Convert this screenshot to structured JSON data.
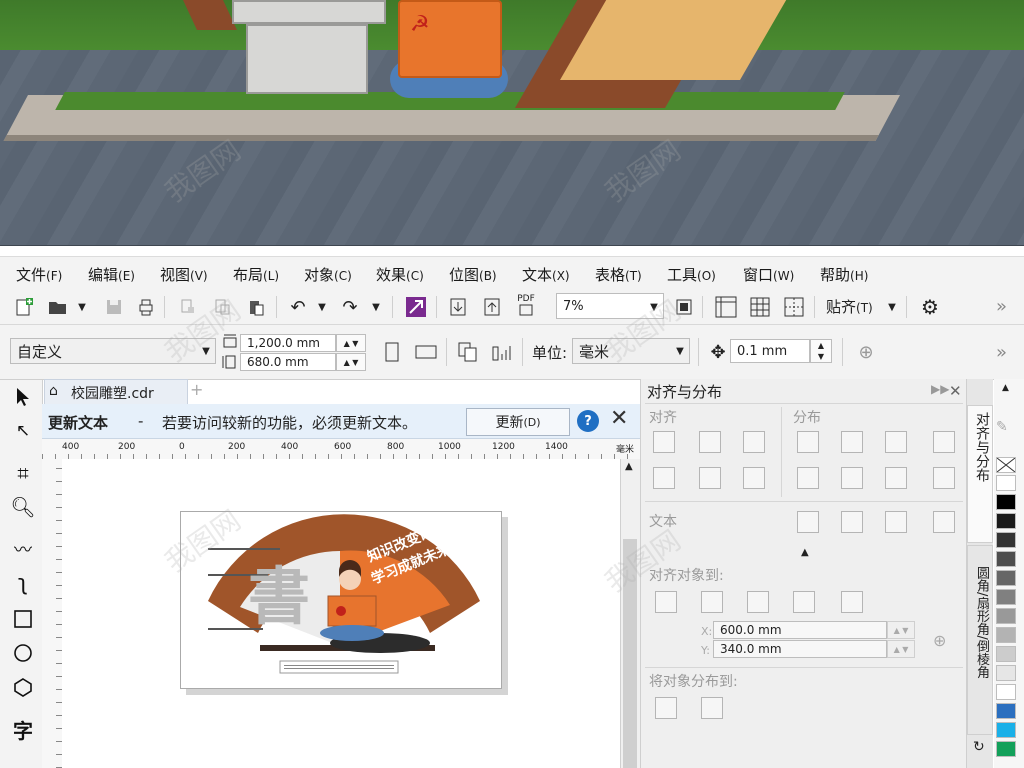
{
  "menu": {
    "items": [
      {
        "label": "文件",
        "key": "(F)"
      },
      {
        "label": "编辑",
        "key": "(E)"
      },
      {
        "label": "视图",
        "key": "(V)"
      },
      {
        "label": "布局",
        "key": "(L)"
      },
      {
        "label": "对象",
        "key": "(C)"
      },
      {
        "label": "效果",
        "key": "(C)"
      },
      {
        "label": "位图",
        "key": "(B)"
      },
      {
        "label": "文本",
        "key": "(X)"
      },
      {
        "label": "表格",
        "key": "(T)"
      },
      {
        "label": "工具",
        "key": "(O)"
      },
      {
        "label": "窗口",
        "key": "(W)"
      },
      {
        "label": "帮助",
        "key": "(H)"
      }
    ]
  },
  "toolbar": {
    "zoom_value": "7%",
    "snap_label": "贴齐",
    "snap_key": "(T)",
    "pdf_label": "PDF",
    "more": "»"
  },
  "property_bar": {
    "page_preset": "自定义",
    "width_value": "1,200.0 mm",
    "height_value": "680.0 mm",
    "unit_label": "单位:",
    "unit_value": "毫米",
    "nudge_value": "0.1 mm",
    "more": "»"
  },
  "document": {
    "tab_name": "校园雕塑.cdr",
    "add_tab": "+"
  },
  "notification": {
    "title": "更新文本",
    "dash": "-",
    "message": "若要访问较新的功能，必须更新文本。",
    "button_label": "更新",
    "button_key": "(D)",
    "help": "?",
    "close": "✕"
  },
  "ruler": {
    "ticks": [
      "400",
      "200",
      "0",
      "200",
      "400",
      "600",
      "800",
      "1000",
      "1200",
      "1400"
    ],
    "unit": "毫米"
  },
  "artwork": {
    "slogan_line1": "知识改变命运",
    "slogan_line2": "学习成就未来",
    "big_char": "書",
    "colors": {
      "brown": "#a0552a",
      "orange": "#e7742e",
      "gray": "#b9b9b9"
    }
  },
  "docker": {
    "title": "对齐与分布",
    "align_label": "对齐",
    "distribute_label": "分布",
    "text_label": "文本",
    "align_to_label": "对齐对象到:",
    "x_label": "X:",
    "y_label": "Y:",
    "x_value": "600.0 mm",
    "y_value": "340.0 mm",
    "distribute_to_label": "将对象分布到:"
  },
  "side_tabs": {
    "tab1": "对齐与分布",
    "tab2": "圆角/扇形角/倒棱角"
  },
  "palette": {
    "colors": [
      "#ffffff",
      "#000000",
      "#1a1a1a",
      "#333333",
      "#4d4d4d",
      "#666666",
      "#808080",
      "#999999",
      "#b3b3b3",
      "#cccccc",
      "#e6e6e6",
      "#ffffff",
      "#2b6fbf",
      "#1ab0e8",
      "#13a05a"
    ]
  },
  "watermark": "我图网"
}
